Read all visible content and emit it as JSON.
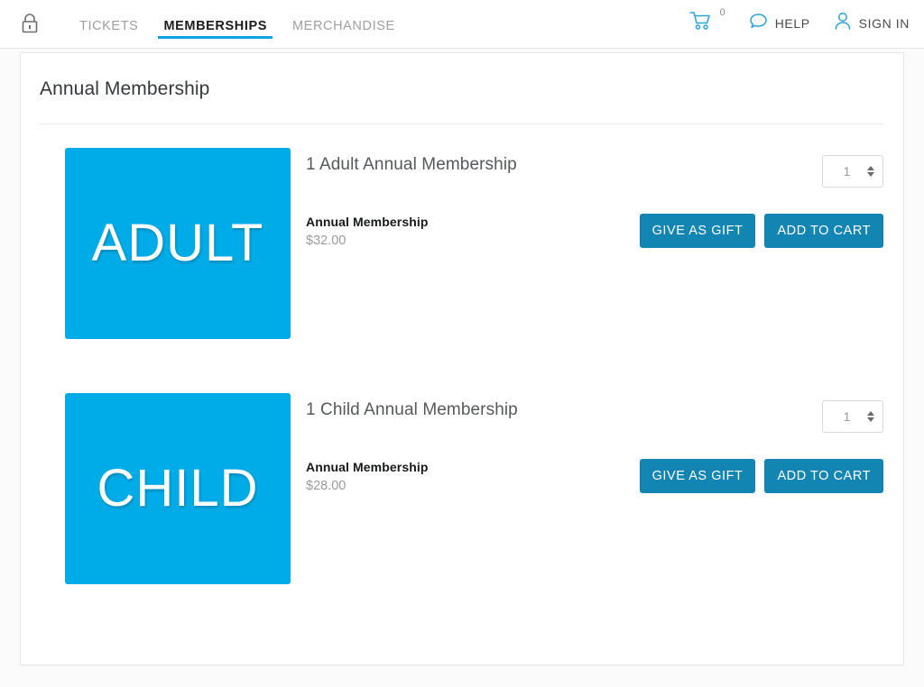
{
  "header": {
    "lock_icon": "lock-icon",
    "tabs": [
      {
        "label": "TICKETS",
        "active": false
      },
      {
        "label": "MEMBERSHIPS",
        "active": true
      },
      {
        "label": "MERCHANDISE",
        "active": false
      }
    ],
    "cart": {
      "icon": "shopping-cart-icon",
      "count": "0"
    },
    "help": {
      "icon": "chat-bubble-icon",
      "label": "HELP"
    },
    "signin": {
      "icon": "user-icon",
      "label": "SIGN IN"
    }
  },
  "card": {
    "title": "Annual Membership"
  },
  "products": [
    {
      "image_text": "ADULT",
      "image_color": "#00ace8",
      "heading": "1 Adult Annual Membership",
      "subtitle": "Annual Membership",
      "price": "$32.00",
      "quantity": "1",
      "gift_label": "GIVE AS GIFT",
      "cart_label": "ADD TO CART"
    },
    {
      "image_text": "CHILD",
      "image_color": "#00ace8",
      "heading": "1 Child Annual Membership",
      "subtitle": "Annual Membership",
      "price": "$28.00",
      "quantity": "1",
      "gift_label": "GIVE AS GIFT",
      "cart_label": "ADD TO CART"
    }
  ],
  "colors": {
    "accent_blue": "#0da3e2",
    "button_blue": "#1385b3",
    "image_blue": "#00ace8"
  }
}
